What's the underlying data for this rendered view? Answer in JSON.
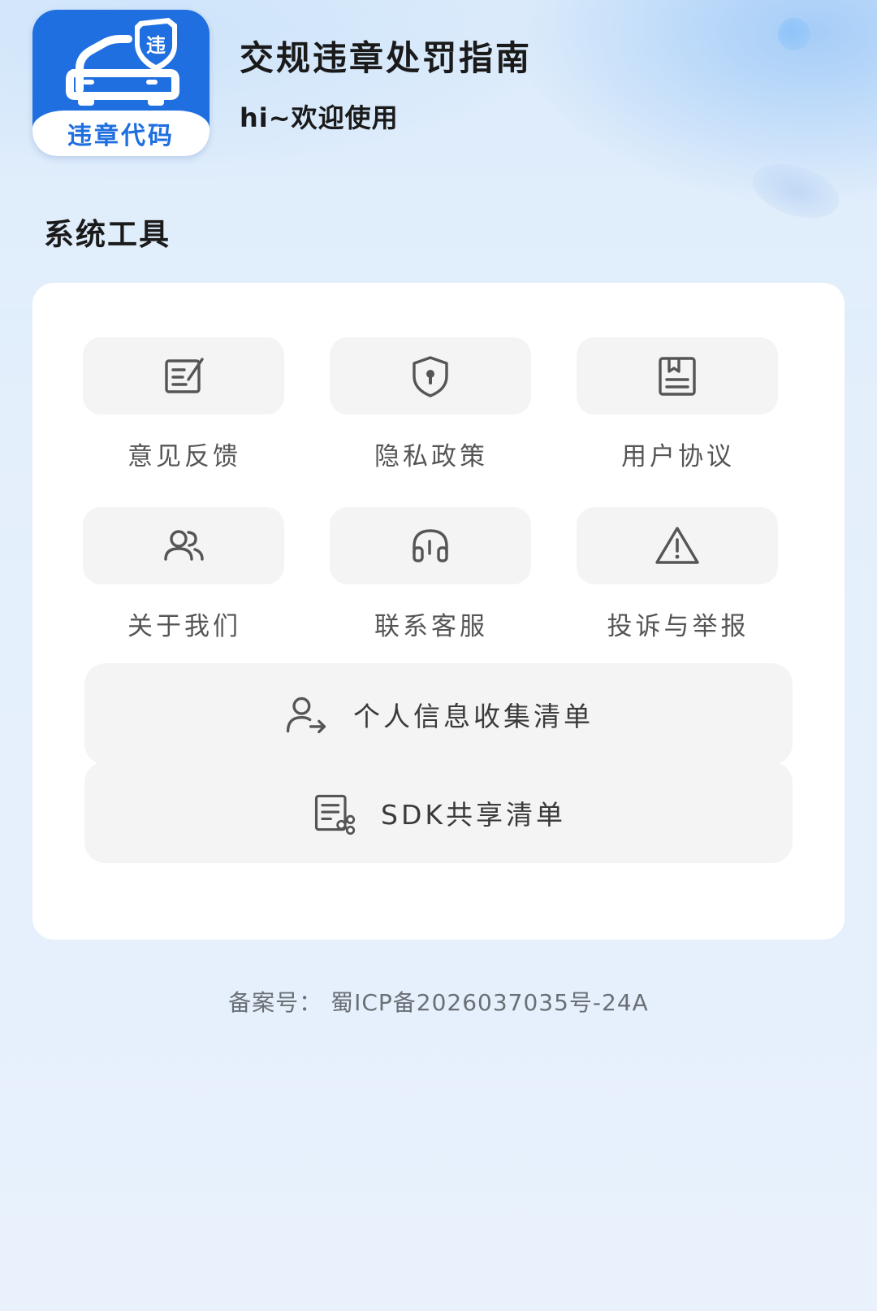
{
  "header": {
    "logo_text": "违章代码",
    "logo_badge": "违",
    "app_title": "交规违章处罚指南",
    "greeting": "hi~欢迎使用"
  },
  "section": {
    "title": "系统工具"
  },
  "tools": [
    {
      "label": "意见反馈",
      "icon": "edit-note-icon"
    },
    {
      "label": "隐私政策",
      "icon": "shield-lock-icon"
    },
    {
      "label": "用户协议",
      "icon": "document-icon"
    },
    {
      "label": "关于我们",
      "icon": "users-icon"
    },
    {
      "label": "联系客服",
      "icon": "headset-icon"
    },
    {
      "label": "投诉与举报",
      "icon": "warning-icon"
    }
  ],
  "wide_buttons": [
    {
      "label": "个人信息收集清单",
      "icon": "user-export-icon"
    },
    {
      "label": "SDK共享清单",
      "icon": "list-share-icon"
    }
  ],
  "footer": {
    "icp": "备案号： 蜀ICP备2026037035号-24A"
  },
  "colors": {
    "brand": "#1f6fe0",
    "icon_gray": "#555555",
    "tile_bg": "#f4f4f4"
  }
}
